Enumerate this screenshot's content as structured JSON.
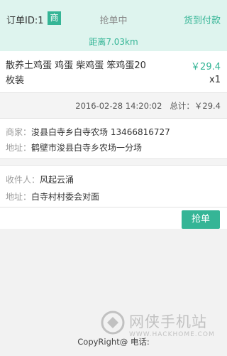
{
  "header": {
    "order_id": "订单ID:1",
    "tag": "商",
    "status": "抢单中",
    "payment": "货到付款",
    "distance": "距离7.03km"
  },
  "product": {
    "name": "散养土鸡蛋 鸡蛋 柴鸡蛋 笨鸡蛋20枚装",
    "price": "￥29.4",
    "quantity": "x1"
  },
  "meta": {
    "datetime": "2016-02-28 14:20:02",
    "total_label": "总计：",
    "total_value": "￥29.4"
  },
  "merchant": {
    "label": "商家：",
    "value": "浚县白寺乡白寺农场 13466816727",
    "address_label": "地址：",
    "address_value": "鹤壁市浚县白寺乡农场一分场"
  },
  "receiver": {
    "label": "收件人：",
    "value": "风起云涌",
    "address_label": "地址：",
    "address_value": "白寺村村委会对面"
  },
  "action": {
    "grab_label": "抢单"
  },
  "footer": {
    "copyright": "CopyRight@ 电话:"
  },
  "watermark": {
    "text": "网侠手机站",
    "url": "WWW.HACKHOME.COM"
  },
  "colors": {
    "accent": "#35b596",
    "header_bg": "#def4ee"
  }
}
